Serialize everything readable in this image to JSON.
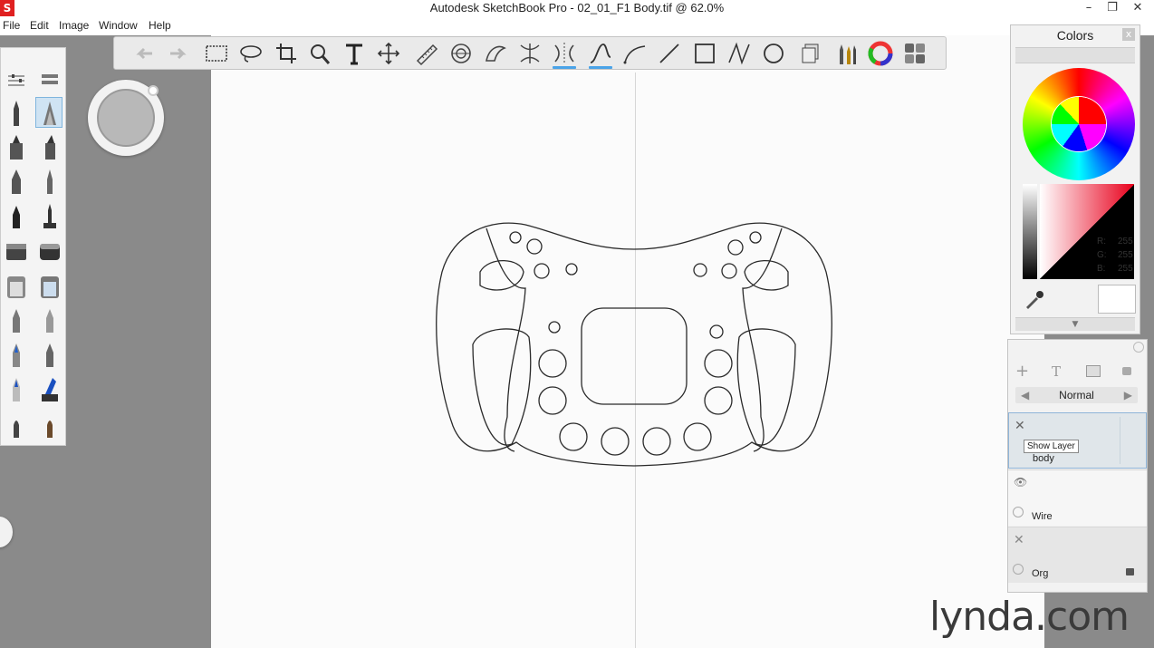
{
  "window": {
    "title": "Autodesk SketchBook Pro - 02_01_F1 Body.tif @ 62.0%",
    "app_icon": "S"
  },
  "window_controls": {
    "minimize": "–",
    "maximize": "❐",
    "close": "✕"
  },
  "menu": {
    "items": [
      "File",
      "Edit",
      "Image",
      "Window",
      "Help"
    ]
  },
  "toolbar": {
    "tools": [
      "undo-icon",
      "redo-icon",
      "rect-select-icon",
      "lasso-icon",
      "crop-icon",
      "zoom-icon",
      "text-icon",
      "move-icon",
      "ruler-icon",
      "ellipse-guide-icon",
      "french-curve-icon",
      "symmetry-x-icon",
      "symmetry-icon",
      "stroke-icon",
      "curve-icon",
      "line-icon",
      "rectangle-icon",
      "polyline-icon",
      "ellipse-icon",
      "layers-icon",
      "brushes-icon",
      "color-wheel-icon",
      "palette-icon"
    ],
    "active": [
      "symmetry-icon",
      "stroke-icon"
    ]
  },
  "colors_panel": {
    "title": "Colors",
    "close": "x",
    "r_label": "R:",
    "g_label": "G:",
    "b_label": "B:",
    "r": "255",
    "g": "255",
    "b": "255",
    "current_color": "#ffffff"
  },
  "layers_panel": {
    "blend_mode": "Normal",
    "layers": [
      {
        "name": "body",
        "visible": false,
        "selected": true,
        "tooltip": "Show Layer"
      },
      {
        "name": "Wire",
        "visible": true,
        "selected": false
      },
      {
        "name": "Org",
        "visible": false,
        "selected": false,
        "locked": true
      }
    ]
  },
  "watermark": "lynda.com"
}
